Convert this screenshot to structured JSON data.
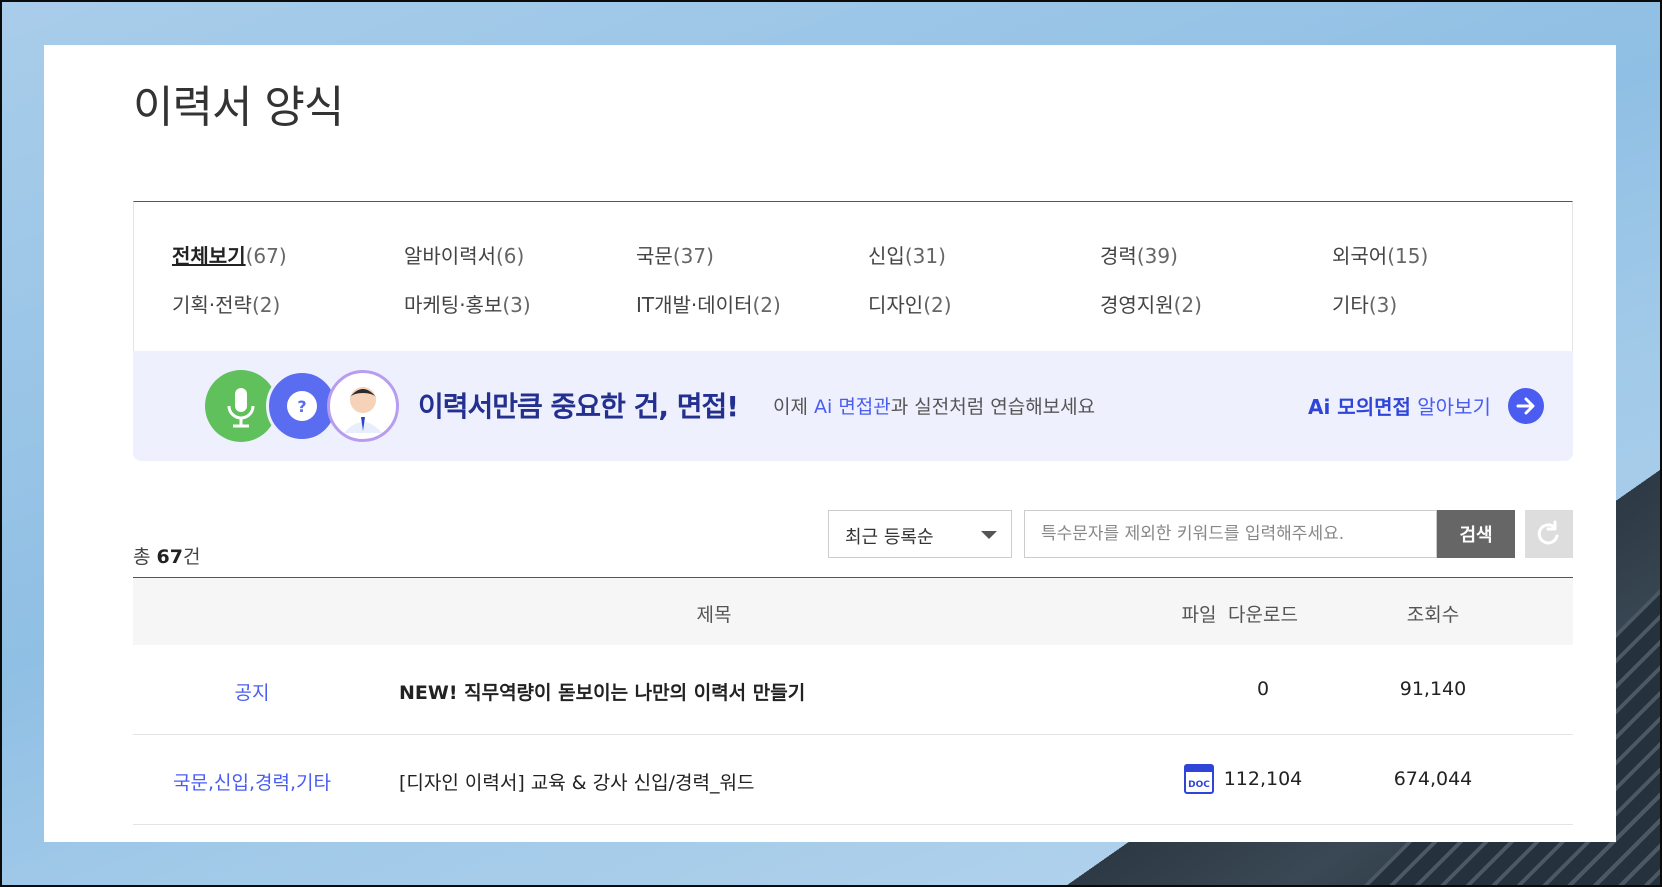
{
  "page": {
    "title": "이력서 양식"
  },
  "categories": [
    {
      "label": "전체보기",
      "count": "(67)",
      "active": true
    },
    {
      "label": "알바이력서",
      "count": "(6)"
    },
    {
      "label": "국문",
      "count": "(37)"
    },
    {
      "label": "신입",
      "count": "(31)"
    },
    {
      "label": "경력",
      "count": "(39)"
    },
    {
      "label": "외국어",
      "count": "(15)"
    },
    {
      "label": "기획·전략",
      "count": "(2)"
    },
    {
      "label": "마케팅·홍보",
      "count": "(3)"
    },
    {
      "label": "IT개발·데이터",
      "count": "(2)"
    },
    {
      "label": "디자인",
      "count": "(2)"
    },
    {
      "label": "경영지원",
      "count": "(2)"
    },
    {
      "label": "기타",
      "count": "(3)"
    }
  ],
  "banner": {
    "headline": "이력서만큼 중요한 건, 면접!",
    "sub_prefix": "이제 ",
    "sub_highlight": "Ai 면접관",
    "sub_suffix": "과 실전처럼 연습해보세요",
    "link_bold": "Ai 모의면접",
    "link_thin": " 알아보기",
    "bubble_icons": [
      "microphone-icon",
      "question-icon",
      "interviewer-avatar"
    ],
    "arrow_icon": "arrow-right-icon"
  },
  "toolbar": {
    "total_prefix": "총 ",
    "total_count": "67",
    "total_suffix": "건",
    "sort_value": "최근 등록순",
    "search_placeholder": "특수문자를 제외한 키워드를 입력해주세요.",
    "search_label": "검색",
    "reset_icon": "refresh-icon"
  },
  "table": {
    "headers": {
      "title": "제목",
      "file": "파일",
      "download": "다운로드",
      "views": "조회수"
    },
    "rows": [
      {
        "category": "공지",
        "title": "NEW! 직무역량이 돋보이는 나만의 이력서 만들기",
        "file": "",
        "downloads": "0",
        "views": "91,140"
      },
      {
        "category": "국문,신입,경력,기타",
        "title": "[디자인 이력서] 교육 & 강사 신입/경력_워드",
        "file": "DOC",
        "downloads": "112,104",
        "views": "674,044"
      }
    ]
  },
  "colors": {
    "accent": "#4a5df0",
    "banner_bg": "#eef1fd",
    "headline": "#24308f"
  }
}
